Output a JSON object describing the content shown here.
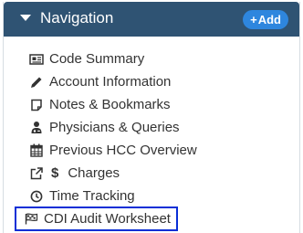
{
  "header": {
    "title": "Navigation",
    "add_label": "Add",
    "add_plus": "+"
  },
  "menu": {
    "items": [
      {
        "label": "Code Summary",
        "icon": "newspaper-icon"
      },
      {
        "label": "Account Information",
        "icon": "pencil-icon"
      },
      {
        "label": "Notes & Bookmarks",
        "icon": "note-icon"
      },
      {
        "label": "Physicians & Queries",
        "icon": "user-md-icon"
      },
      {
        "label": "Previous HCC Overview",
        "icon": "calendar-icon"
      },
      {
        "label": "Charges",
        "icon": "external-link-icon",
        "prefix": "$"
      },
      {
        "label": "Time Tracking",
        "icon": "clock-icon"
      },
      {
        "label": "CDI Audit Worksheet",
        "icon": "flag-checkered-icon",
        "selected": true
      }
    ]
  },
  "colors": {
    "header_bg": "#2f5373",
    "add_button": "#2e86de",
    "selection_border": "#0a2fd6",
    "text": "#333333"
  }
}
